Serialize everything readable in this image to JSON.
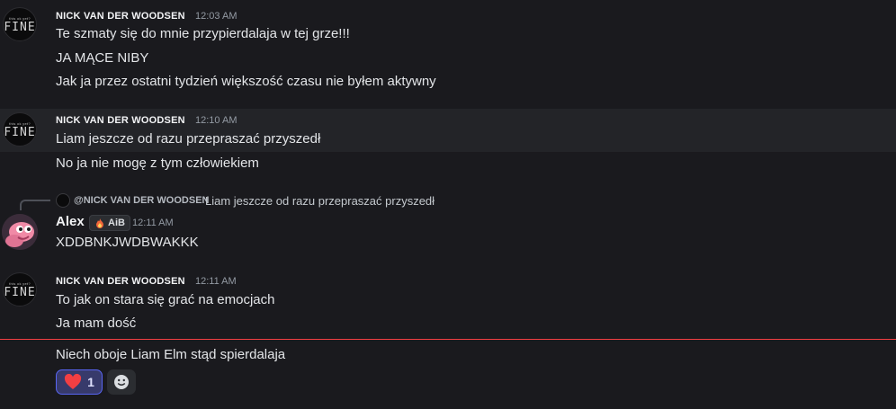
{
  "messages": [
    {
      "author": "NICK VAN DER WOODSEN",
      "time": "12:03 AM",
      "avatar_text_small": "this ok yet?",
      "avatar_text": "FINE",
      "lines": [
        "Te szmaty się do mnie przypierdalaja w tej grze!!!",
        "JA MĄCE NIBY",
        "Jak ja przez ostatni tydzień większość czasu nie byłem aktywny"
      ]
    },
    {
      "author": "NICK VAN DER WOODSEN",
      "time": "12:10 AM",
      "avatar_text_small": "this ok yet?",
      "avatar_text": "FINE",
      "lines": [
        "Liam jeszcze od razu przepraszać przyszedł",
        "No ja nie mogę z tym człowiekiem"
      ]
    },
    {
      "reply": {
        "author": "@NICK VAN DER WOODSEN",
        "text": "Liam jeszcze od razu przepraszać przyszedł"
      },
      "author": "Alex",
      "badge": "AiB",
      "time": "12:11 AM",
      "lines": [
        "XDDBNKJWDBWAKKK"
      ]
    },
    {
      "author": "NICK VAN DER WOODSEN",
      "time": "12:11 AM",
      "avatar_text_small": "this ok yet?",
      "avatar_text": "FINE",
      "lines": [
        "To jak on stara się grać na emocjach",
        "Ja mam dość",
        "Niech oboje Liam Elm stąd spierdalaja"
      ]
    }
  ],
  "reactions": [
    {
      "emoji": "heart-icon",
      "count": "1",
      "color": "#f23f43"
    }
  ],
  "colors": {
    "background": "#1a1a1e",
    "new_divider": "#f23f43",
    "reaction_active": "#5865f2"
  }
}
